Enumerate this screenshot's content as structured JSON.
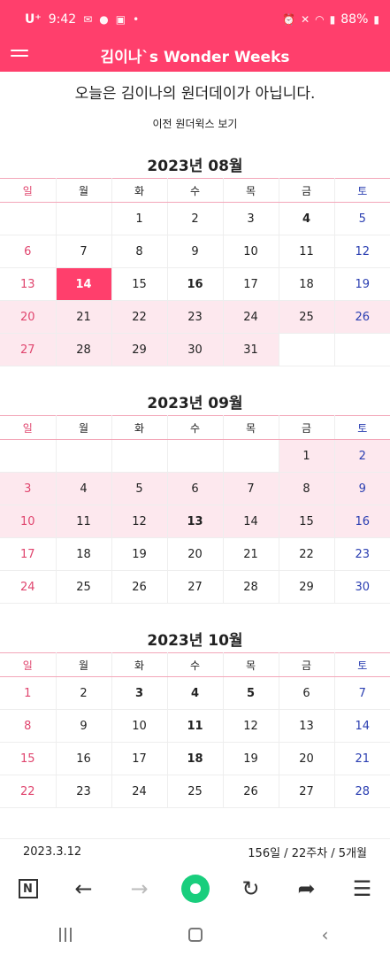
{
  "status": {
    "carrier": "U⁺",
    "time": "9:42",
    "battery": "88%",
    "left_icons": [
      "chat-app-icon",
      "talk-icon",
      "live-icon",
      "dot-icon"
    ],
    "right_icons": [
      "alarm-icon",
      "mute-icon",
      "wifi-icon",
      "signal-icon",
      "battery-icon"
    ]
  },
  "app": {
    "title": "김이나`s Wonder Weeks",
    "headline": "오늘은 김이나의 원더데이가 아닙니다.",
    "prev_link": "이전 원더윅스 보기"
  },
  "weekdays": [
    "일",
    "월",
    "화",
    "수",
    "목",
    "금",
    "토"
  ],
  "months": [
    {
      "title": "2023년 08월",
      "rows": [
        [
          "",
          "",
          "1",
          "2",
          "3",
          "4",
          "5"
        ],
        [
          "6",
          "7",
          "8",
          "9",
          "10",
          "11",
          "12"
        ],
        [
          "13",
          "14",
          "15",
          "16",
          "17",
          "18",
          "19"
        ],
        [
          "20",
          "21",
          "22",
          "23",
          "24",
          "25",
          "26"
        ],
        [
          "27",
          "28",
          "29",
          "30",
          "31",
          "",
          ""
        ]
      ]
    },
    {
      "title": "2023년 09월",
      "rows": [
        [
          "",
          "",
          "",
          "",
          "",
          "1",
          "2"
        ],
        [
          "3",
          "4",
          "5",
          "6",
          "7",
          "8",
          "9"
        ],
        [
          "10",
          "11",
          "12",
          "13",
          "14",
          "15",
          "16"
        ],
        [
          "17",
          "18",
          "19",
          "20",
          "21",
          "22",
          "23"
        ],
        [
          "24",
          "25",
          "26",
          "27",
          "28",
          "29",
          "30"
        ]
      ]
    },
    {
      "title": "2023년 10월",
      "rows": [
        [
          "1",
          "2",
          "3",
          "4",
          "5",
          "6",
          "7"
        ],
        [
          "8",
          "9",
          "10",
          "11",
          "12",
          "13",
          "14"
        ],
        [
          "15",
          "16",
          "17",
          "18",
          "19",
          "20",
          "21"
        ],
        [
          "22",
          "23",
          "24",
          "25",
          "26",
          "27",
          "28"
        ]
      ]
    }
  ],
  "footer": {
    "left": "2023.3.12",
    "right": "156일 / 22주차 / 5개월"
  },
  "browser_toolbar": [
    "n-icon",
    "back-icon",
    "forward-icon",
    "green-home-icon",
    "refresh-icon",
    "share-icon",
    "menu-icon"
  ],
  "system_nav": [
    "recents-icon",
    "home-icon",
    "back-icon"
  ],
  "colors": {
    "accent": "#ff3f6c",
    "highlight": "#fde8ee",
    "sunday": "#e0456e",
    "saturday": "#2a3eb1",
    "green": "#19ce7d"
  }
}
